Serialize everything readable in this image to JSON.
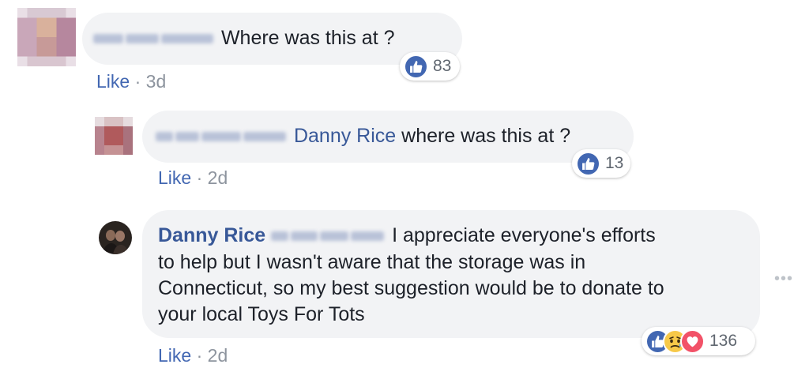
{
  "comments": [
    {
      "text": "Where was this at ?",
      "like_label": "Like",
      "separator": "·",
      "time": "3d",
      "reactions": {
        "types": [
          "like-icon"
        ],
        "count": "83"
      }
    },
    {
      "tag": "Danny Rice",
      "text": "where was this at ?",
      "like_label": "Like",
      "separator": "·",
      "time": "2d",
      "reactions": {
        "types": [
          "like-icon"
        ],
        "count": "13"
      }
    },
    {
      "author": "Danny Rice",
      "lines": [
        "I appreciate everyone's efforts",
        "to help but I wasn't aware that the storage was in",
        "Connecticut, so my best suggestion would be to donate to",
        "your local Toys For Tots"
      ],
      "like_label": "Like",
      "separator": "·",
      "time": "2d",
      "reactions": {
        "types": [
          "like-icon",
          "sad-icon",
          "love-icon"
        ],
        "count": "136"
      }
    }
  ],
  "more_options_glyph": "•••",
  "colors": {
    "bubble": "#f2f3f5",
    "link": "#385898",
    "like_blue": "#4267b2",
    "meta_gray": "#8d949e",
    "love_red": "#f25268",
    "sad_yellow": "#f7c949"
  }
}
